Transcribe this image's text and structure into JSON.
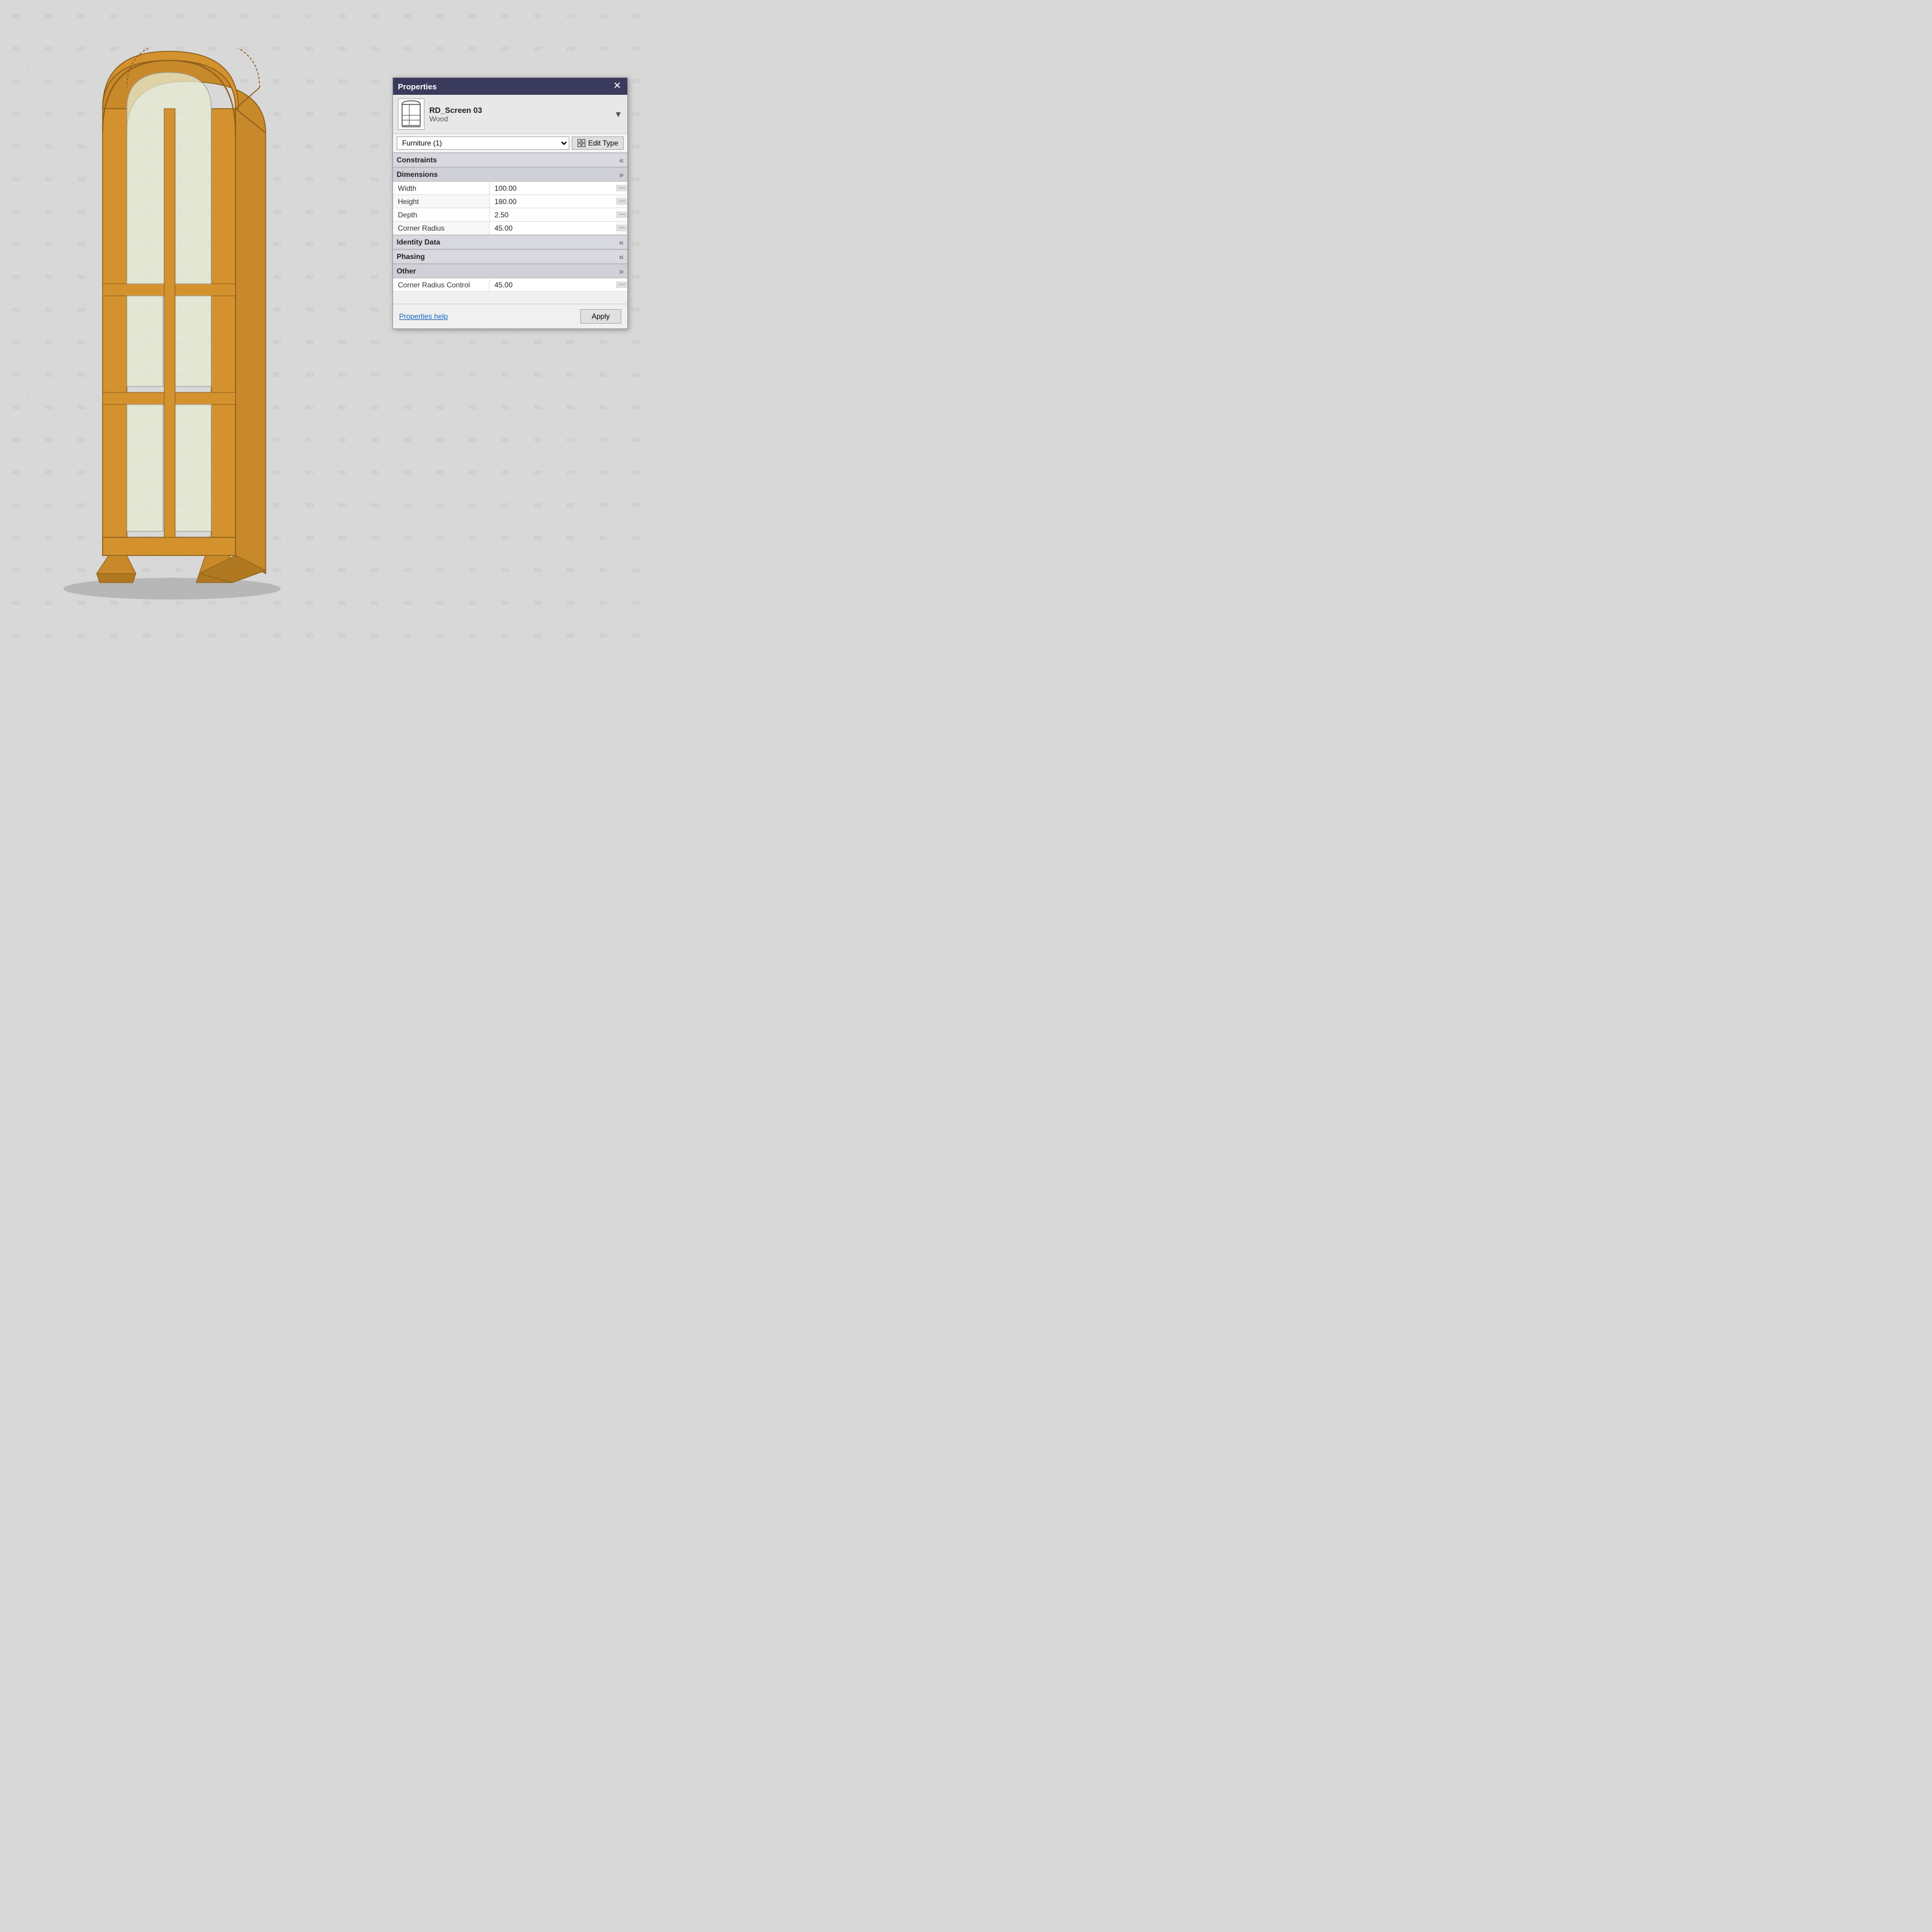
{
  "watermark": {
    "text": "RD"
  },
  "panel": {
    "title": "Properties",
    "close_label": "✕",
    "item_name": "RD_Screen 03",
    "item_sub": "Wood",
    "dropdown_arrow": "▼",
    "family_select_value": "Furniture (1)",
    "edit_type_label": "Edit Type",
    "sections": {
      "constraints": {
        "label": "Constraints",
        "toggle": "«"
      },
      "dimensions": {
        "label": "Dimensions",
        "toggle": "»",
        "properties": [
          {
            "label": "Width",
            "value": "100.00"
          },
          {
            "label": "Height",
            "value": "180.00"
          },
          {
            "label": "Depth",
            "value": "2.50"
          },
          {
            "label": "Corner Radius",
            "value": "45.00"
          }
        ]
      },
      "identity_data": {
        "label": "Identity Data",
        "toggle": "«"
      },
      "phasing": {
        "label": "Phasing",
        "toggle": "«"
      },
      "other": {
        "label": "Other",
        "toggle": "»",
        "properties": [
          {
            "label": "Corner Radius Control",
            "value": "45.00"
          }
        ]
      }
    },
    "footer": {
      "help_link": "Properties help",
      "apply_label": "Apply"
    }
  }
}
